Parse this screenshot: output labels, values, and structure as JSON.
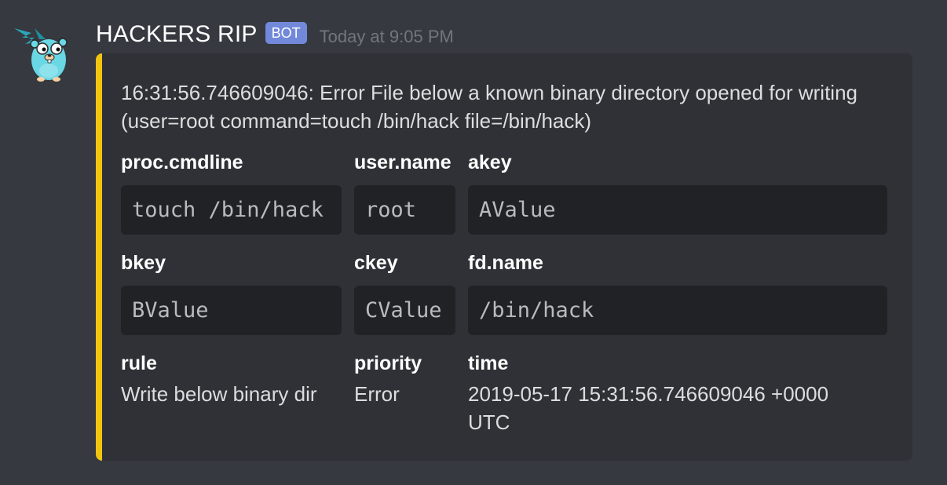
{
  "message": {
    "username": "HACKERS RIP",
    "badge": "BOT",
    "timestamp": "Today at 9:05 PM"
  },
  "embed": {
    "accent_color": "#f1c40f",
    "description": "16:31:56.746609046: Error File below a known binary directory opened for writing (user=root command=touch /bin/hack file=/bin/hack)",
    "fields": [
      {
        "name": "proc.cmdline",
        "value": "touch /bin/hack",
        "style": "code"
      },
      {
        "name": "user.name",
        "value": "root",
        "style": "code"
      },
      {
        "name": "akey",
        "value": "AValue",
        "style": "code"
      },
      {
        "name": "bkey",
        "value": "BValue",
        "style": "code"
      },
      {
        "name": "ckey",
        "value": "CValue",
        "style": "code"
      },
      {
        "name": "fd.name",
        "value": "/bin/hack",
        "style": "code"
      },
      {
        "name": "rule",
        "value": "Write below binary dir",
        "style": "text"
      },
      {
        "name": "priority",
        "value": "Error",
        "style": "text"
      },
      {
        "name": "time",
        "value": "2019-05-17 15:31:56.746609046 +0000 UTC",
        "style": "text"
      }
    ]
  },
  "colors": {
    "background": "#36393f",
    "embed_background": "#2f3136",
    "code_background": "#202225",
    "badge": "#7289da"
  },
  "icons": {
    "avatar": "gopher-mascot-avatar"
  }
}
